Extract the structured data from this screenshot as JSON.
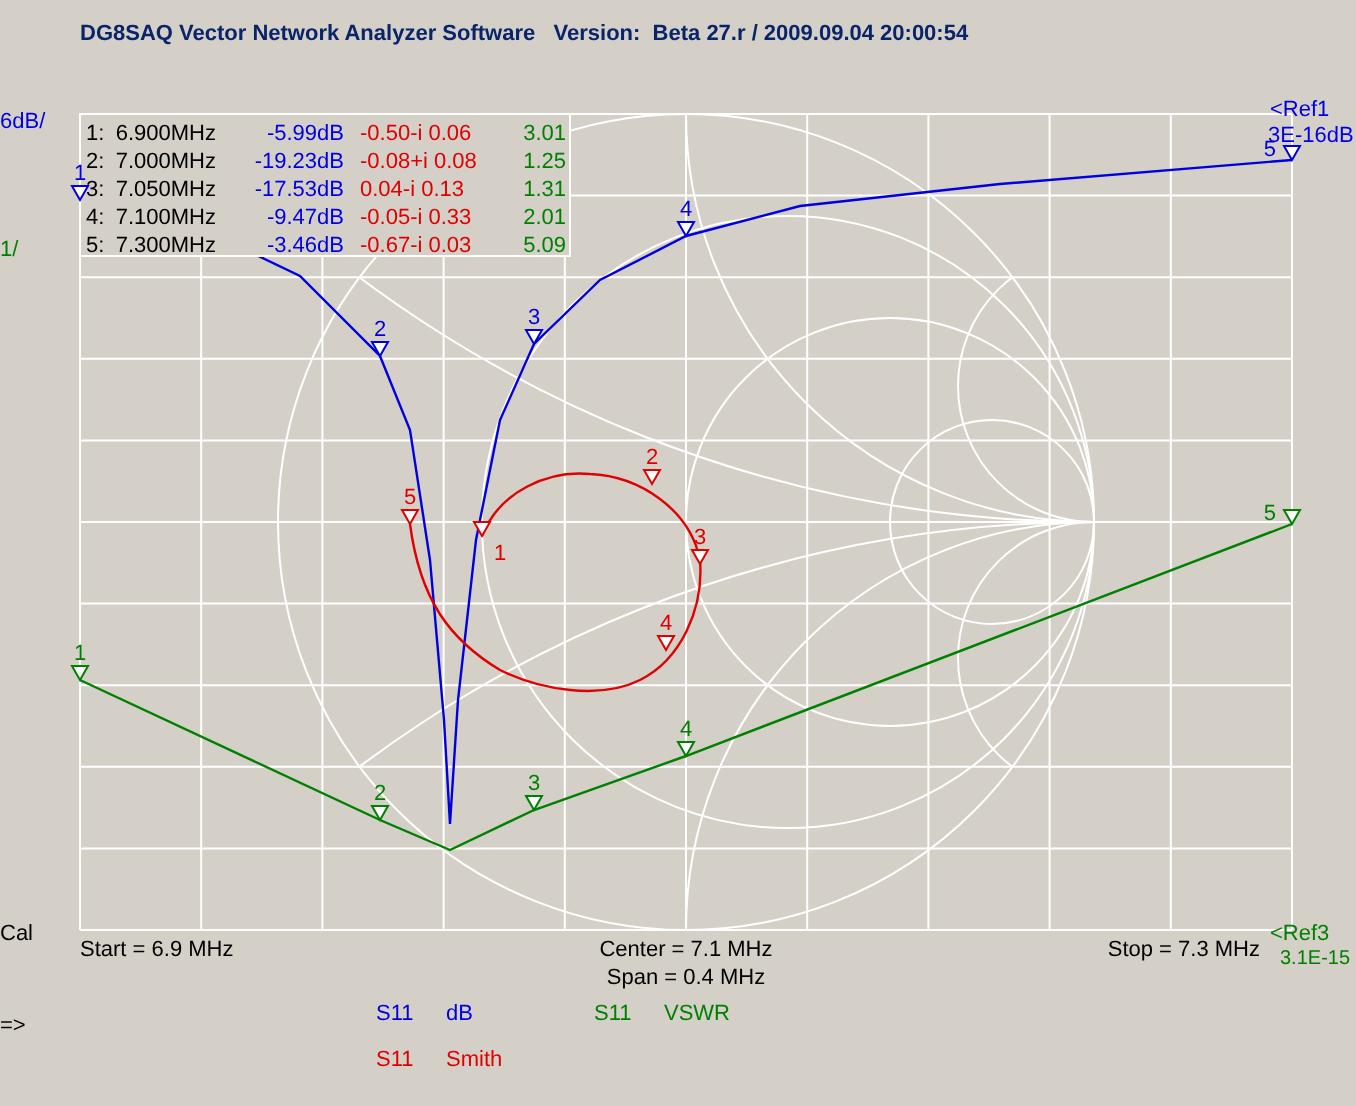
{
  "window": {
    "title": "DG8SAQ Vector Network Analyzer Software   Version:  Beta 27.r / 2009.09.04 20:00:54"
  },
  "traces": [
    {
      "kind": "db",
      "parameter": "S11",
      "format": "dB",
      "color": "#0000e0",
      "scale": "6dB/",
      "reference": "<Ref1",
      "reference_value": "3E-16dB",
      "markers": [
        "1",
        "2",
        "3",
        "4",
        "5"
      ]
    },
    {
      "kind": "smith",
      "parameter": "S11",
      "format": "Smith",
      "color": "#e00000",
      "markers": [
        "1",
        "2",
        "3",
        "4",
        "5"
      ]
    },
    {
      "kind": "vswr",
      "parameter": "S11",
      "format": "VSWR",
      "color": "#008000",
      "scale": "1/",
      "reference": "<Ref3",
      "reference_value": "3.1E-15",
      "markers": [
        "1",
        "2",
        "3",
        "4",
        "5"
      ]
    }
  ],
  "marker_table": [
    {
      "index": "1:",
      "frequency": "6.900MHz",
      "db": "-5.99dB",
      "smith": "-0.50-i 0.06",
      "vswr": "3.01"
    },
    {
      "index": "2:",
      "frequency": "7.000MHz",
      "db": "-19.23dB",
      "smith": "-0.08+i 0.08",
      "vswr": "1.25"
    },
    {
      "index": "3:",
      "frequency": "7.050MHz",
      "db": "-17.53dB",
      "smith": "0.04-i 0.13",
      "vswr": "1.31"
    },
    {
      "index": "4:",
      "frequency": "7.100MHz",
      "db": "-9.47dB",
      "smith": "-0.05-i 0.33",
      "vswr": "2.01"
    },
    {
      "index": "5:",
      "frequency": "7.300MHz",
      "db": "-3.46dB",
      "smith": "-0.67-i 0.03",
      "vswr": "5.09"
    }
  ],
  "sweep": {
    "start": "Start = 6.9 MHz",
    "center": "Center = 7.1 MHz",
    "span": "Span = 0.4 MHz",
    "stop": "Stop = 7.3 MHz"
  },
  "side_labels": [
    "Cal",
    "=>"
  ]
}
